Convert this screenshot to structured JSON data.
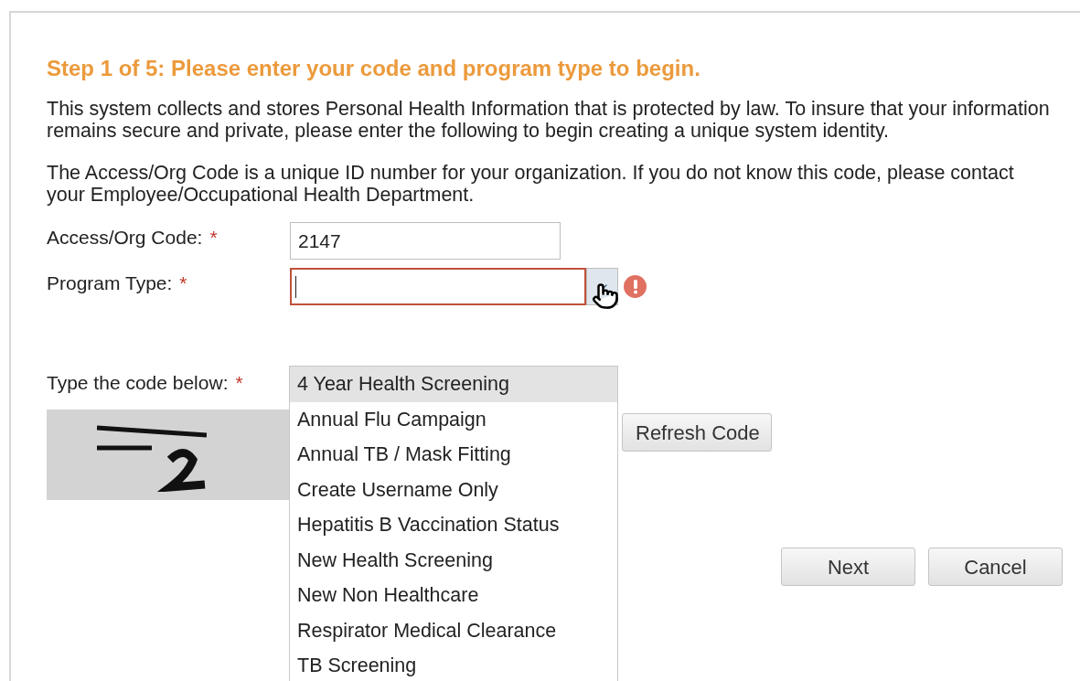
{
  "heading": "Step 1 of 5: Please enter your code and program type to begin.",
  "paragraphs": [
    "This system collects and stores Personal Health Information that is protected by law. To insure that your information remains secure and private, please enter the following to begin creating a unique system identity.",
    "The Access/Org Code is a unique ID number for your organization. If you do not know this code, please contact your Employee/Occupational Health Department."
  ],
  "access_code": {
    "label": "Access/Org Code:",
    "required_mark": "*",
    "value": "2147"
  },
  "program_type": {
    "label": "Program Type:",
    "required_mark": "*",
    "invalid": true,
    "expanded": true,
    "options": [
      {
        "label": "4 Year Health Screening",
        "selected": true
      },
      {
        "label": "Annual Flu Campaign",
        "selected": false
      },
      {
        "label": "Annual TB / Mask Fitting",
        "selected": false
      },
      {
        "label": "Create Username Only",
        "selected": false
      },
      {
        "label": "Hepatitis B Vaccination Status",
        "selected": false
      },
      {
        "label": "New Health Screening",
        "selected": false
      },
      {
        "label": "New Non Healthcare",
        "selected": false
      },
      {
        "label": "Respirator Medical Clearance",
        "selected": false
      },
      {
        "label": "TB Screening",
        "selected": false
      }
    ]
  },
  "captcha": {
    "label": "Type the code below:",
    "required_mark": "*",
    "refresh_button": "Refresh Code"
  },
  "buttons": [
    "Next",
    "Cancel"
  ]
}
